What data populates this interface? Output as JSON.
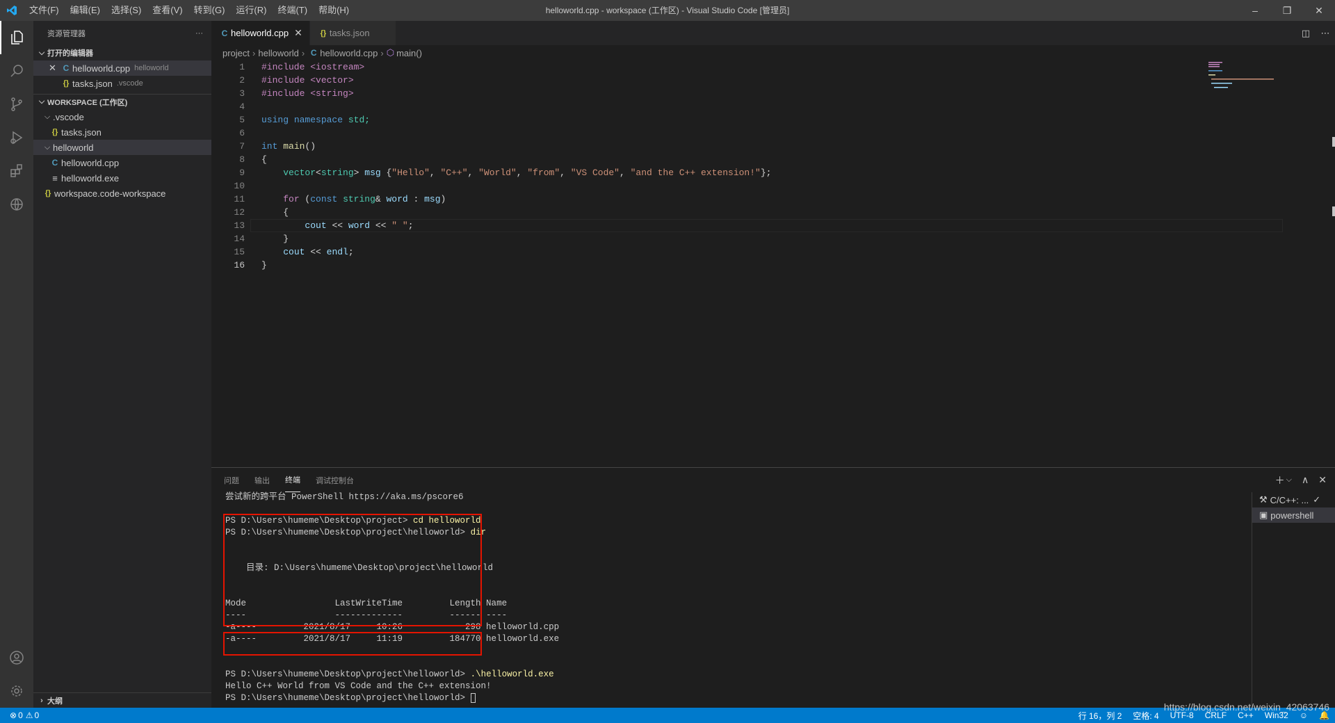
{
  "titlebar": {
    "menu": [
      "文件(F)",
      "编辑(E)",
      "选择(S)",
      "查看(V)",
      "转到(G)",
      "运行(R)",
      "终端(T)",
      "帮助(H)"
    ],
    "title": "helloworld.cpp - workspace (工作区) - Visual Studio Code [管理员]"
  },
  "sidebar": {
    "title": "资源管理器",
    "more": "···",
    "open_editors_label": "打开的编辑器",
    "open_editors": [
      {
        "name": "helloworld.cpp",
        "desc": "helloworld",
        "icon": "C"
      },
      {
        "name": "tasks.json",
        "desc": ".vscode",
        "icon": "{}"
      }
    ],
    "workspace_label": "WORKSPACE (工作区)",
    "tree": {
      "vscode_folder": ".vscode",
      "tasks_file": "tasks.json",
      "helloworld_folder": "helloworld",
      "cpp_file": "helloworld.cpp",
      "exe_file": "helloworld.exe",
      "workspace_file": "workspace.code-workspace"
    },
    "outline_label": "大纲"
  },
  "tabs": [
    {
      "label": "helloworld.cpp",
      "icon": "C"
    },
    {
      "label": "tasks.json",
      "icon": "{}"
    }
  ],
  "breadcrumb": [
    "project",
    "helloworld",
    "helloworld.cpp",
    "main()"
  ],
  "code": {
    "line_numbers": [
      "1",
      "2",
      "3",
      "4",
      "5",
      "6",
      "7",
      "8",
      "9",
      "10",
      "11",
      "12",
      "13",
      "14",
      "15",
      "16"
    ],
    "l1": "#include <iostream>",
    "l2": "#include <vector>",
    "l3": "#include <string>",
    "l5a": "using",
    "l5b": "namespace",
    "l5c": "std;",
    "l7a": "int",
    "l7b": "main",
    "l9a": "vector",
    "l9b": "<",
    "l9c": "string",
    "l9d": "> ",
    "l9e": "msg",
    "l9s1": "\"Hello\"",
    "l9s2": "\"C++\"",
    "l9s3": "\"World\"",
    "l9s4": "\"from\"",
    "l9s5": "\"VS Code\"",
    "l9s6": "\"and the C++ extension!\"",
    "l11a": "for",
    "l11b": "const",
    "l11c": "string",
    "l11d": "word",
    "l11e": "msg",
    "l13a": "cout",
    "l13b": "word",
    "l13c": "\" \"",
    "l15a": "cout",
    "l15b": "endl"
  },
  "panel": {
    "tabs": [
      "问题",
      "输出",
      "终端",
      "调试控制台"
    ],
    "terminal_lines": {
      "t1": "尝试新的跨平台 PowerShell https://aka.ms/pscore6",
      "t3p": "PS D:\\Users\\humeme\\Desktop\\project> ",
      "t3c": "cd helloworld",
      "t4p": "PS D:\\Users\\humeme\\Desktop\\project\\helloworld> ",
      "t4c": "dir",
      "t7": "    目录: D:\\Users\\humeme\\Desktop\\project\\helloworld",
      "t10": "Mode                 LastWriteTime         Length Name",
      "t11": "----                 -------------         ------ ----",
      "t12": "-a----         2021/8/17     10:26            298 helloworld.cpp",
      "t13": "-a----         2021/8/17     11:19         184770 helloworld.exe",
      "t16p": "PS D:\\Users\\humeme\\Desktop\\project\\helloworld> ",
      "t16c": ".\\helloworld.exe",
      "t17": "Hello C++ World from VS Code and the C++ extension!",
      "t18": "PS D:\\Users\\humeme\\Desktop\\project\\helloworld> "
    },
    "terminal_list": [
      "C/C++: ...",
      "powershell"
    ]
  },
  "status": {
    "errors": "0",
    "warnings": "0",
    "position": "行 16，列 2",
    "spaces": "空格: 4",
    "encoding": "UTF-8",
    "eol": "CRLF",
    "language": "C++",
    "platform": "Win32"
  },
  "watermark": "https://blog.csdn.net/weixin_42063746"
}
